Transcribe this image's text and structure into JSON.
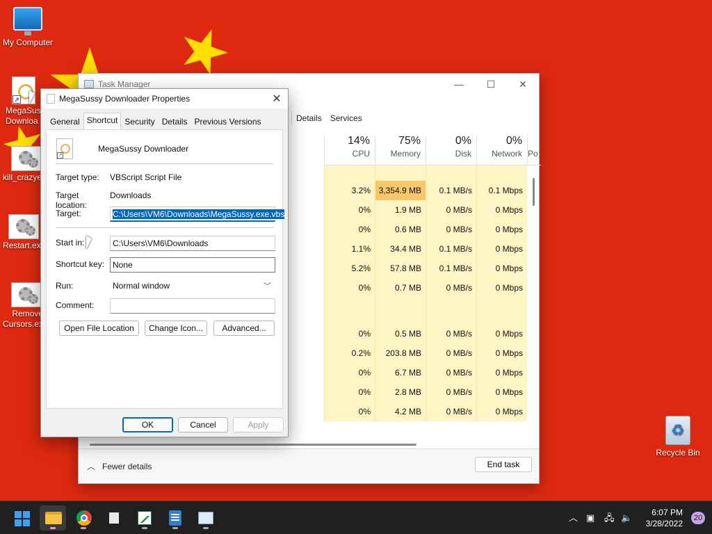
{
  "desktop": {
    "icons": [
      {
        "label": "My Computer",
        "icon": "monitor-icon"
      },
      {
        "label": "MegaSussy Downloader",
        "label_visible": "MegaSus\nDownloa",
        "icon": "vbs-shortcut-icon"
      },
      {
        "label": "kill_crazye",
        "icon": "script-gear-icon"
      },
      {
        "label": "Restart.exe",
        "icon": "script-gear-icon"
      },
      {
        "label": "Remove Cursors.ex",
        "icon": "script-gear-icon"
      },
      {
        "label": "Recycle Bin",
        "icon": "recycle-bin-icon"
      }
    ],
    "colors": {
      "background": "#de2910",
      "stars": "#ffde00"
    }
  },
  "taskmgr": {
    "title": "Task Manager",
    "tabs": [
      "Details",
      "Services"
    ],
    "columns": [
      {
        "pct": "14%",
        "name": "CPU"
      },
      {
        "pct": "75%",
        "name": "Memory"
      },
      {
        "pct": "0%",
        "name": "Disk"
      },
      {
        "pct": "0%",
        "name": "Network"
      },
      {
        "pct": "",
        "name": "Po"
      }
    ],
    "rows": [
      [
        "",
        "",
        "",
        ""
      ],
      [
        "3.2%",
        "3,354.9 MB",
        "0.1 MB/s",
        "0.1 Mbps"
      ],
      [
        "0%",
        "1.9 MB",
        "0 MB/s",
        "0 Mbps"
      ],
      [
        "0%",
        "0.6 MB",
        "0 MB/s",
        "0 Mbps"
      ],
      [
        "1.1%",
        "34.4 MB",
        "0.1 MB/s",
        "0 Mbps"
      ],
      [
        "5.2%",
        "57.8 MB",
        "0.1 MB/s",
        "0 Mbps"
      ],
      [
        "0%",
        "0.7 MB",
        "0 MB/s",
        "0 Mbps"
      ],
      [
        "",
        "",
        "",
        ""
      ],
      [
        "0%",
        "0.5 MB",
        "0 MB/s",
        "0 Mbps"
      ],
      [
        "0.2%",
        "203.8 MB",
        "0 MB/s",
        "0 Mbps"
      ],
      [
        "0%",
        "6.7 MB",
        "0 MB/s",
        "0 Mbps"
      ],
      [
        "0%",
        "2.8 MB",
        "0 MB/s",
        "0 Mbps"
      ],
      [
        "0%",
        "4.2 MB",
        "0 MB/s",
        "0 Mbps"
      ]
    ],
    "fewer_details": "Fewer details",
    "end_task": "End task",
    "colors": {
      "cell_bg": "#fff4c4",
      "cell_hot": "#f9c86b"
    }
  },
  "props": {
    "title": "MegaSussy Downloader Properties",
    "tabs": [
      "General",
      "Shortcut",
      "Security",
      "Details",
      "Previous Versions"
    ],
    "active_tab": "Shortcut",
    "app_name": "MegaSussy Downloader",
    "target_type_label": "Target type:",
    "target_type": "VBScript Script File",
    "target_location_label": "Target location:",
    "target_location": "Downloads",
    "target_label": "Target:",
    "target": "C:\\Users\\VM6\\Downloads\\MegaSussy.exe.vbs",
    "start_in_label": "Start in:",
    "start_in": "C:\\Users\\VM6\\Downloads",
    "shortcut_key_label": "Shortcut key:",
    "shortcut_key": "None",
    "run_label": "Run:",
    "run": "Normal window",
    "comment_label": "Comment:",
    "comment": "",
    "buttons": {
      "open_location": "Open File Location",
      "change_icon": "Change Icon...",
      "advanced": "Advanced...",
      "ok": "OK",
      "cancel": "Cancel",
      "apply": "Apply"
    }
  },
  "taskbar": {
    "apps": [
      "start-icon",
      "file-explorer-icon",
      "chrome-icon",
      "file-icon",
      "chart-app-icon",
      "notepad-icon",
      "task-manager-icon"
    ],
    "time": "6:07 PM",
    "date": "3/28/2022",
    "notifications": "20"
  }
}
